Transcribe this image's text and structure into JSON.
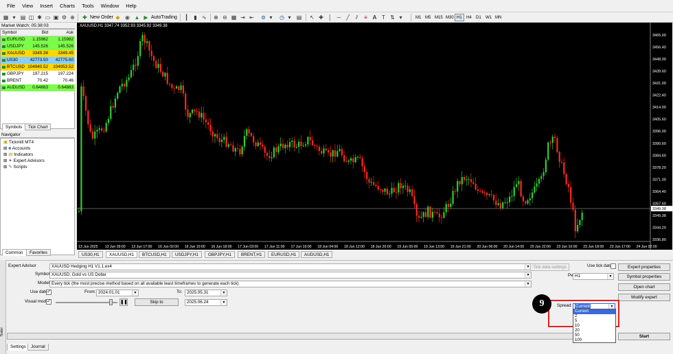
{
  "menu": [
    "File",
    "View",
    "Insert",
    "Charts",
    "Tools",
    "Window",
    "Help"
  ],
  "toolbar": {
    "new_order": "New Order",
    "autotrading": "AutoTrading",
    "timeframes": [
      "M1",
      "M5",
      "M15",
      "M30",
      "H1",
      "H4",
      "D1",
      "W1",
      "MN"
    ],
    "active_tf": "H1"
  },
  "market_watch": {
    "title": "Market Watch: 05:38:03",
    "headers": {
      "symbol": "Symbol",
      "bid": "Bid",
      "ask": "Ask"
    },
    "rows": [
      {
        "symbol": "EURUSD",
        "bid": "1.15982",
        "ask": "1.15982",
        "bg": "#7cfc4a"
      },
      {
        "symbol": "USDJPY",
        "bid": "145.526",
        "ask": "145.526",
        "bg": "#7cfc4a"
      },
      {
        "symbol": "XAUUSD",
        "bid": "3349.38",
        "ask": "3349.45",
        "bg": "#ffd700"
      },
      {
        "symbol": "US30",
        "bid": "42773.50",
        "ask": "42775.60",
        "bg": "#87cefa"
      },
      {
        "symbol": "BTCUSD",
        "bid": "104940.52",
        "ask": "104953.52",
        "bg": "#ffd700"
      },
      {
        "symbol": "GBPJPY",
        "bid": "197.215",
        "ask": "197.224",
        "bg": "#ffffff"
      },
      {
        "symbol": "BRENT",
        "bid": "70.42",
        "ask": "70.46",
        "bg": "#ffffff"
      },
      {
        "symbol": "AUDUSD",
        "bid": "0.64883",
        "ask": "0.64883",
        "bg": "#7cfc4a"
      }
    ],
    "tabs": [
      "Symbols",
      "Tick Chart"
    ]
  },
  "navigator": {
    "title": "Navigator",
    "root": "Tickmill MT4",
    "items": [
      "Accounts",
      "Indicators",
      "Expert Advisors",
      "Scripts"
    ],
    "tabs": [
      "Common",
      "Favorites"
    ]
  },
  "chart": {
    "header": "XAUUSD,H1  3347.74 3352.93 3345.92 3349.38",
    "price_labels": [
      "3465.00",
      "3456.40",
      "3448.00",
      "3439.60",
      "3431.00",
      "3422.40",
      "3414.00",
      "3405.60",
      "3396.00",
      "3390.60",
      "3384.60",
      "3378.20",
      "3371.00",
      "3364.40",
      "3357.60",
      "3349.38",
      "3344.20",
      "3336.80"
    ],
    "current_price": "3349.38",
    "time_labels": [
      "13 Jun 2025",
      "13 Jun 09:00",
      "13 Jun 17:00",
      "16 Jun 02:00",
      "16 Jun 10:00",
      "16 Jun 18:00",
      "17 Jun 03:00",
      "17 Jun 11:00",
      "17 Jun 19:00",
      "18 Jun 04:00",
      "18 Jun 12:00",
      "18 Jun 20:00",
      "19 Jun 05:00",
      "19 Jun 13:00",
      "19 Jun 21:00",
      "20 Jun 06:00",
      "20 Jun 14:00",
      "20 Jun 22:00",
      "23 Jun 10:00",
      "23 Jun 18:00",
      "23 Jun 17:00",
      "24 Jun 02:00"
    ]
  },
  "chart_tabs": [
    "US30,H1",
    "XAUUSD,H1",
    "BTCUSD,H1",
    "USDJPY,H1",
    "GBPJPY,H1",
    "BRENT,H1",
    "EURUSD,H1",
    "AUDUSD,H1"
  ],
  "active_chart_tab": "XAUUSD,H1",
  "tester": {
    "expert_label": "Expert Advisor",
    "expert_value": "XAUUSD Hedging H1 V1.1.ex4",
    "symbol_label": "Symbol:",
    "symbol_value": "XAUUSD, Gold vs US Dollar",
    "model_label": "Model:",
    "model_value": "Every tick (the most precise method based on all available least timeframes to generate each tick)",
    "use_date_label": "Use date",
    "from_label": "From:",
    "from_value": "2024.01.01",
    "to_label": "To:",
    "to_value": "2025.05.31",
    "visual_label": "Visual mode",
    "skip_label": "Skip to",
    "skip_value": "2025.06.24",
    "tick_data_settings": "Tick data settings",
    "use_tick_data": "Use tick data",
    "period_label": "Period:",
    "period_value": "H1",
    "spread_label": "Spread:",
    "spread_value": "Current",
    "spread_options": [
      "Current",
      "2",
      "5",
      "10",
      "20",
      "50",
      "100"
    ],
    "expert_properties": "Expert properties",
    "symbol_properties": "Symbol properties",
    "open_chart": "Open chart",
    "modify_expert": "Modify expert",
    "start": "Start",
    "step_badge": "9",
    "tabs": [
      "Settings",
      "Journal"
    ],
    "side_label": "Tester"
  },
  "colors": {
    "bull": "#2fd02f",
    "bear": "#ff2a1a",
    "chart_bg": "#000000",
    "highlight": "#e02020"
  }
}
